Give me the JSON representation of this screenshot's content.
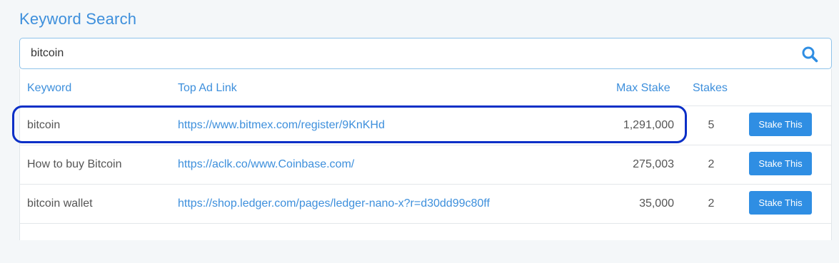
{
  "page": {
    "title": "Keyword Search"
  },
  "search": {
    "value": "bitcoin",
    "icon": "search-icon"
  },
  "table": {
    "headers": {
      "keyword": "Keyword",
      "top_ad_link": "Top Ad Link",
      "max_stake": "Max Stake",
      "stakes": "Stakes"
    },
    "rows": [
      {
        "keyword": "bitcoin",
        "link": "https://www.bitmex.com/register/9KnKHd",
        "max_stake": "1,291,000",
        "stakes": "5",
        "action": "Stake This"
      },
      {
        "keyword": "How to buy Bitcoin",
        "link": "https://aclk.co/www.Coinbase.com/",
        "max_stake": "275,003",
        "stakes": "2",
        "action": "Stake This"
      },
      {
        "keyword": "bitcoin wallet",
        "link": "https://shop.ledger.com/pages/ledger-nano-x?r=d30dd99c80ff",
        "max_stake": "35,000",
        "stakes": "2",
        "action": "Stake This"
      }
    ]
  },
  "colors": {
    "accent": "#3d8fdc",
    "button": "#2f8ee3",
    "highlight": "#0a2fc7",
    "background": "#f4f7f9"
  }
}
